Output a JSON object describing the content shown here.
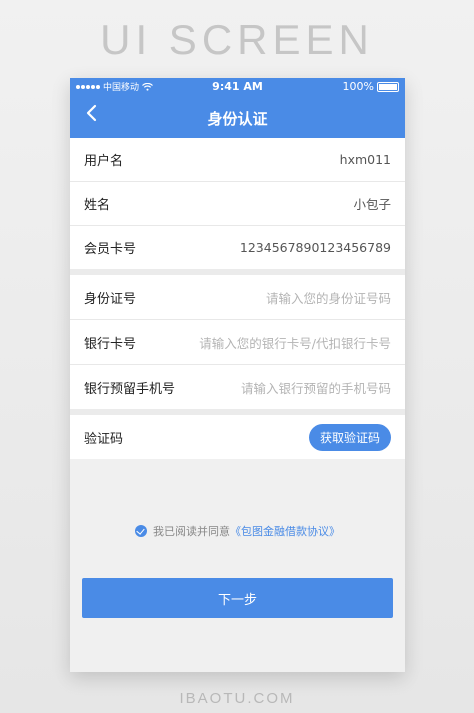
{
  "banner": {
    "title": "UI SCREEN"
  },
  "footer": {
    "brand": "IBAOTU.COM"
  },
  "status_bar": {
    "carrier": "中国移动",
    "time": "9:41 AM",
    "battery": "100%"
  },
  "header": {
    "title": "身份认证"
  },
  "account_group": [
    {
      "label": "用户名",
      "value": "hxm011"
    },
    {
      "label": "姓名",
      "value": "小包子"
    },
    {
      "label": "会员卡号",
      "value": "123456789012345678​9"
    }
  ],
  "bank_group": [
    {
      "label": "身份证号",
      "placeholder": "请输入您的身份证号码"
    },
    {
      "label": "银行卡号",
      "placeholder": "请输入您的银行卡号/代扣银行卡号"
    },
    {
      "label": "银行预留手机号",
      "placeholder": "请输入银行预留的手机号码"
    }
  ],
  "verify": {
    "label": "验证码",
    "button": "获取验证码"
  },
  "agreement": {
    "prefix": "我已阅读并同意",
    "link": "《包图金融借款协议》"
  },
  "next_button": "下一步",
  "colors": {
    "accent": "#4a8be6"
  }
}
